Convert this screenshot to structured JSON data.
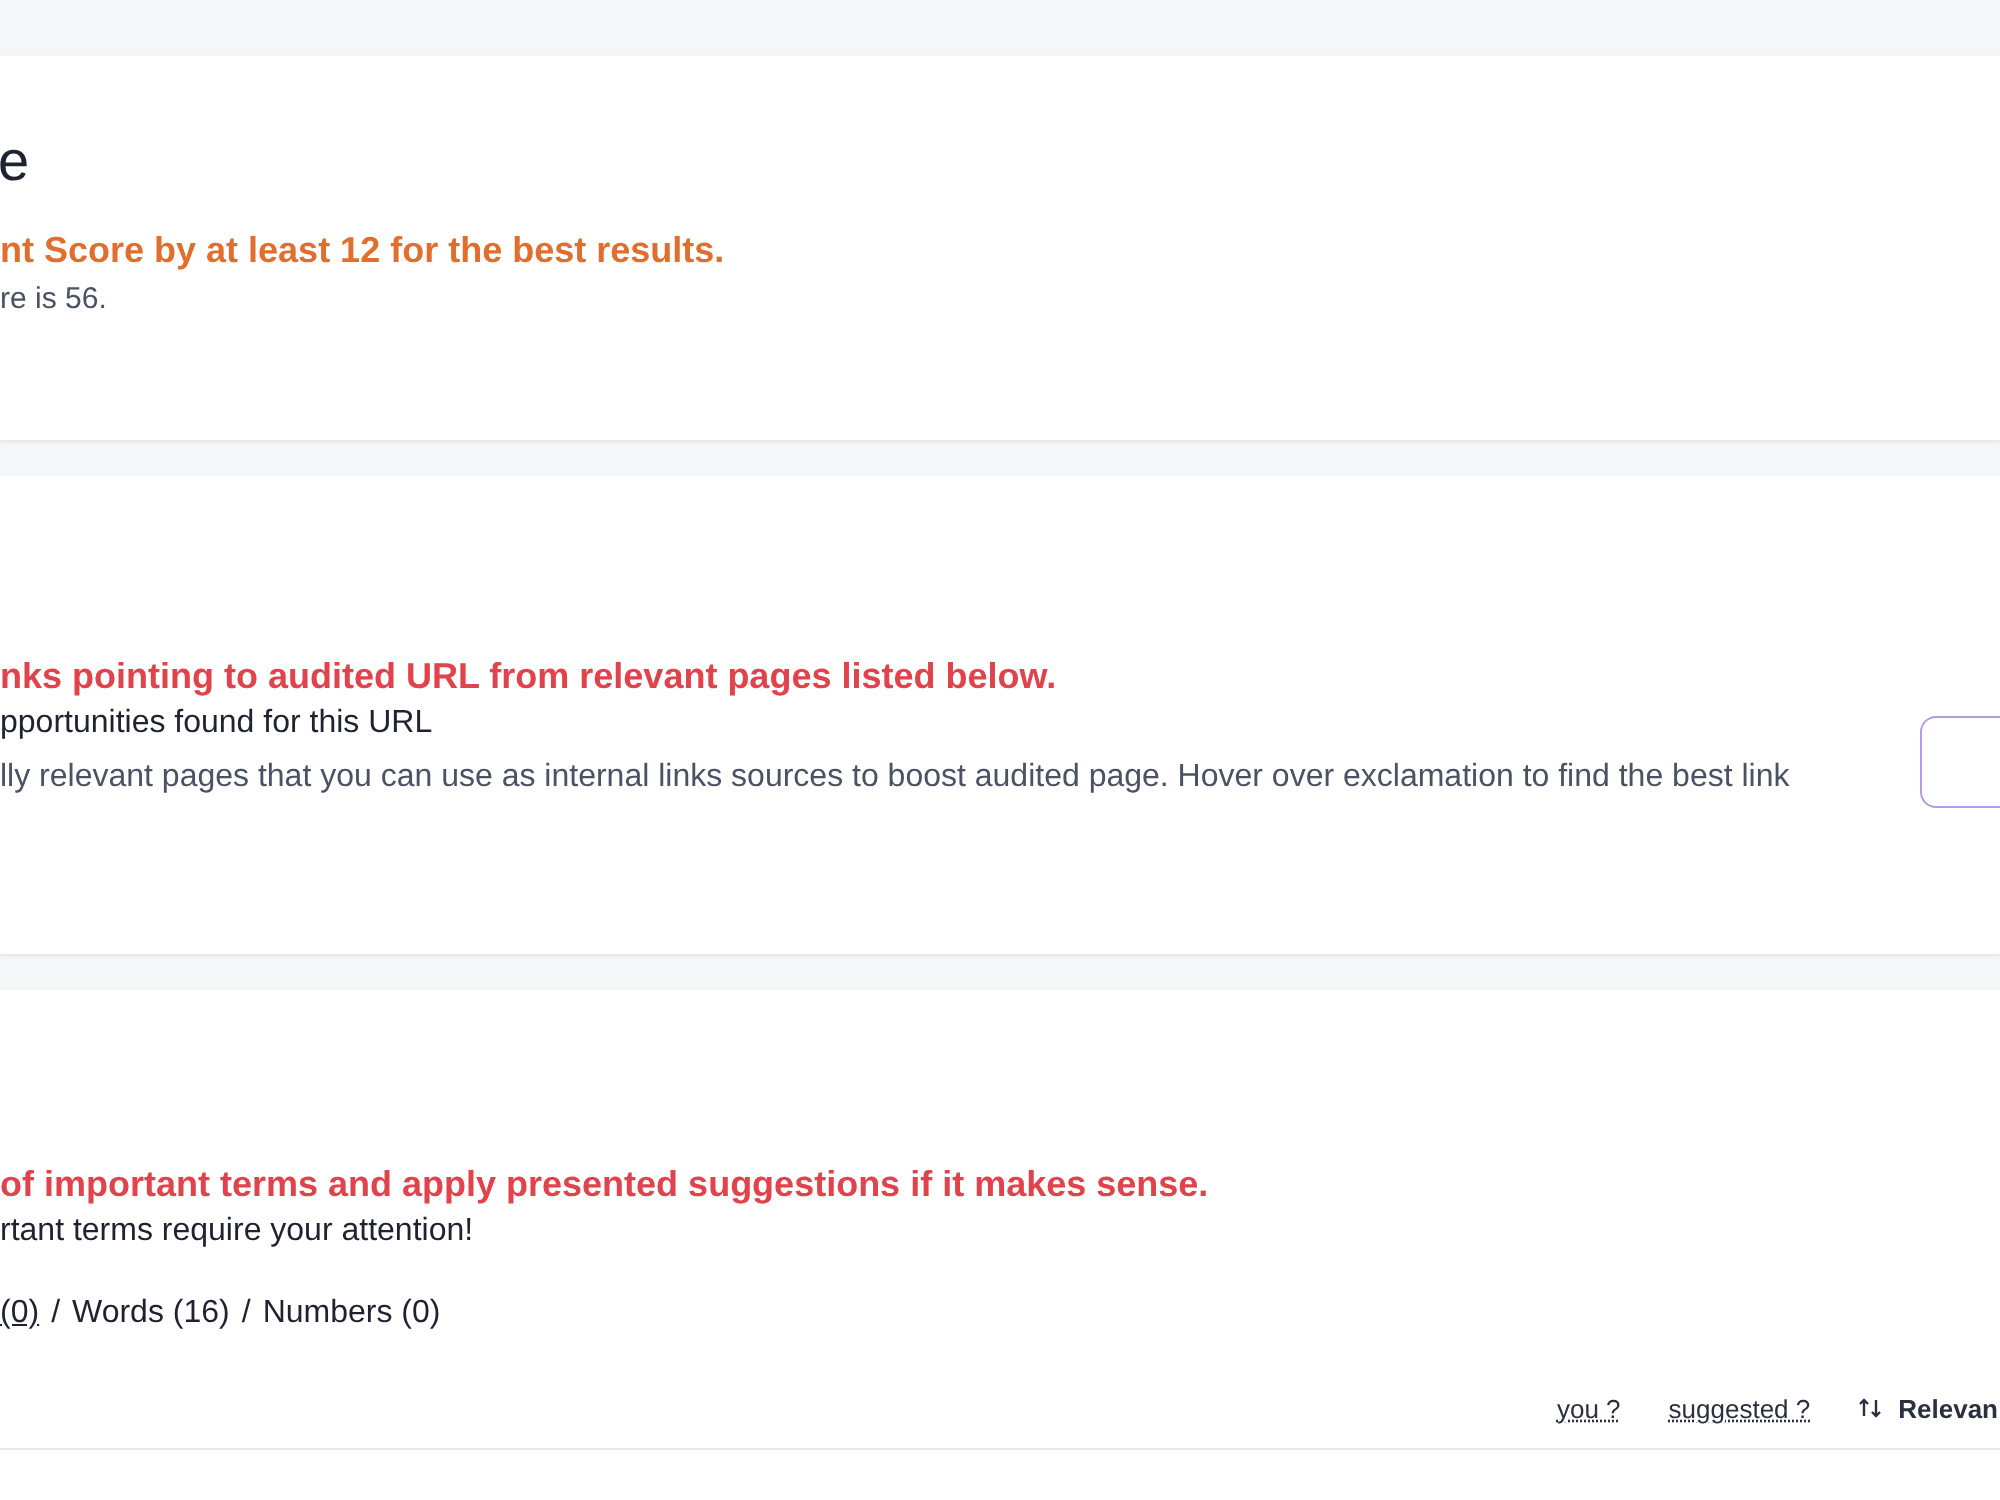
{
  "score_card": {
    "title": "e",
    "warning": "nt Score by at least 12 for the best results.",
    "detail": "re is 56."
  },
  "links_card": {
    "warning": "nks pointing to audited URL from relevant pages listed below.",
    "status": "pportunities found for this URL",
    "description": "lly relevant pages that you can use as internal links sources to boost audited page. Hover over exclamation to find the best link"
  },
  "terms_card": {
    "warning": "of important terms and apply presented suggestions if it makes sense.",
    "status": "rtant terms require your attention!",
    "separator": "/",
    "filters": [
      {
        "label": "(0)",
        "selected": true
      },
      {
        "label": "Words (16)",
        "selected": false
      },
      {
        "label": "Numbers (0)",
        "selected": false
      }
    ],
    "columns": [
      {
        "label": "you ?",
        "kind": "hint"
      },
      {
        "label": "suggested ?",
        "kind": "hint"
      },
      {
        "label": "Relevan",
        "kind": "sort"
      }
    ]
  }
}
